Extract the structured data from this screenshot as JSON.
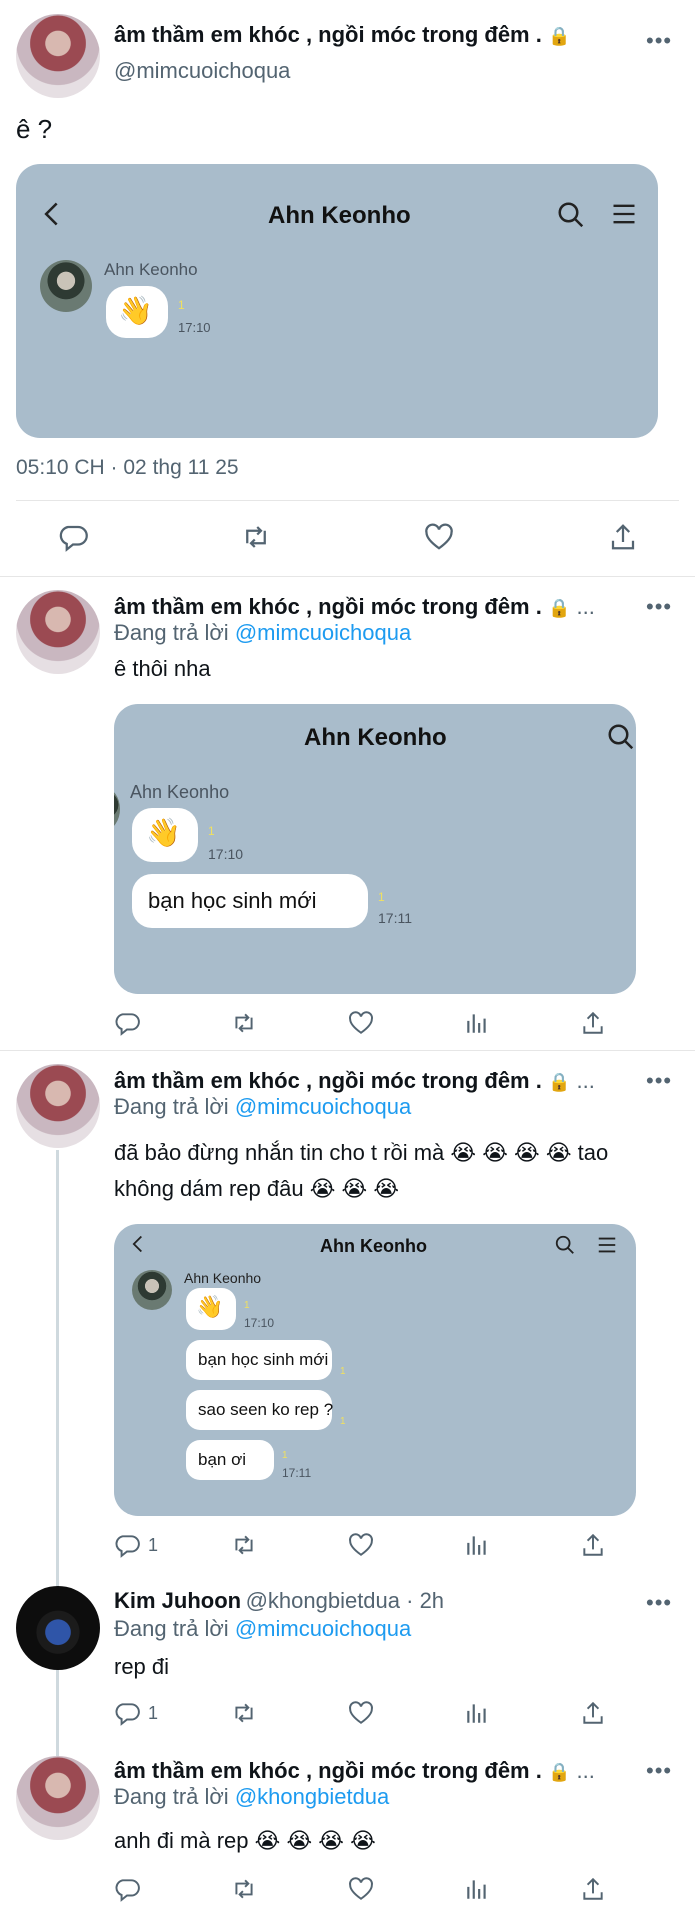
{
  "main_tweet": {
    "display_name": "âm thầm em khóc , ngồi móc trong đêm .",
    "lock": "🔒",
    "handle": "@mimcuoichoqua",
    "text": "ê ?",
    "timestamp": "05:10 CH · 02 thg 11 25",
    "card": {
      "title": "Ahn Keonho",
      "sender": "Ahn Keonho",
      "messages": [
        {
          "text": "👋",
          "time": "17:10",
          "mark": "1"
        }
      ]
    }
  },
  "replies": [
    {
      "display_name": "âm thầm em khóc , ngồi móc trong đêm .",
      "lock": "🔒",
      "ellipsis": "...",
      "reply_prefix": "Đang trả lời",
      "reply_to": "@mimcuoichoqua",
      "text": "ê thôi nha",
      "card": {
        "title": "Ahn Keonho",
        "sender": "Ahn Keonho",
        "messages": [
          {
            "text": "👋",
            "time": "17:10",
            "mark": "1"
          },
          {
            "text": "bạn học sinh mới",
            "time": "17:11",
            "mark": "1"
          }
        ]
      }
    },
    {
      "display_name": "âm thầm em khóc , ngồi móc trong đêm .",
      "lock": "🔒",
      "ellipsis": "...",
      "reply_prefix": "Đang trả lời",
      "reply_to": "@mimcuoichoqua",
      "text_line1": "đã bảo đừng nhắn tin cho t rồi mà 😭 😭 😭 😭  tao",
      "text_line2": "không dám rep đâu 😭 😭 😭",
      "reply_count": "1",
      "card": {
        "title": "Ahn Keonho",
        "sender": "Ahn Keonho",
        "messages": [
          {
            "text": "👋",
            "time": "17:10",
            "mark": "1"
          },
          {
            "text": "bạn học sinh mới",
            "time": "",
            "mark": "1"
          },
          {
            "text": "sao seen ko rep ?",
            "time": "",
            "mark": "1"
          },
          {
            "text": "bạn ơi",
            "time": "17:11",
            "mark": "1"
          }
        ]
      }
    },
    {
      "display_name": "Kim Juhoon",
      "handle_time": "@khongbietdua · 2h",
      "reply_prefix": "Đang trả lời",
      "reply_to": "@mimcuoichoqua",
      "text": "rep đi",
      "reply_count": "1"
    },
    {
      "display_name": "âm thầm em khóc , ngồi móc trong đêm .",
      "lock": "🔒",
      "ellipsis": "...",
      "reply_prefix": "Đang trả lời",
      "reply_to": "@khongbietdua",
      "text": "anh đi mà rep 😭 😭 😭 😭"
    }
  ],
  "more_icon": "•••",
  "colors": {
    "card_bg": "#a9bccb",
    "link": "#1d9bf0",
    "muted": "#536471"
  }
}
